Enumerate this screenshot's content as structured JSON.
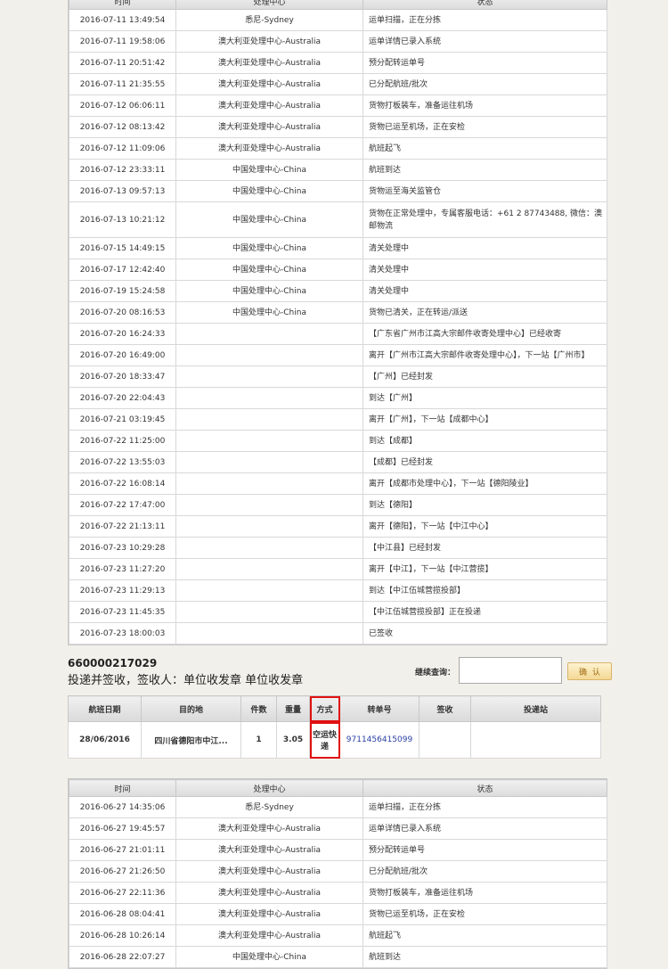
{
  "table1": {
    "headers": {
      "time": "时间",
      "center": "处理中心",
      "status": "状态"
    },
    "rows": [
      {
        "time": "2016-07-11 13:49:54",
        "center": "悉尼-Sydney",
        "status": "运单扫描，正在分拣"
      },
      {
        "time": "2016-07-11 19:58:06",
        "center": "澳大利亚处理中心-Australia",
        "status": "运单详情已录入系统"
      },
      {
        "time": "2016-07-11 20:51:42",
        "center": "澳大利亚处理中心-Australia",
        "status": "预分配转运单号"
      },
      {
        "time": "2016-07-11 21:35:55",
        "center": "澳大利亚处理中心-Australia",
        "status": "已分配航班/批次"
      },
      {
        "time": "2016-07-12 06:06:11",
        "center": "澳大利亚处理中心-Australia",
        "status": "货物打板装车，准备运往机场"
      },
      {
        "time": "2016-07-12 08:13:42",
        "center": "澳大利亚处理中心-Australia",
        "status": "货物已运至机场，正在安检"
      },
      {
        "time": "2016-07-12 11:09:06",
        "center": "澳大利亚处理中心-Australia",
        "status": "航班起飞"
      },
      {
        "time": "2016-07-12 23:33:11",
        "center": "中国处理中心-China",
        "status": "航班到达"
      },
      {
        "time": "2016-07-13 09:57:13",
        "center": "中国处理中心-China",
        "status": "货物运至海关监管仓"
      },
      {
        "time": "2016-07-13 10:21:12",
        "center": "中国处理中心-China",
        "status": "货物在正常处理中，专属客服电话：+61 2 87743488, 微信：澳邮物流"
      },
      {
        "time": "2016-07-15 14:49:15",
        "center": "中国处理中心-China",
        "status": "清关处理中"
      },
      {
        "time": "2016-07-17 12:42:40",
        "center": "中国处理中心-China",
        "status": "清关处理中"
      },
      {
        "time": "2016-07-19 15:24:58",
        "center": "中国处理中心-China",
        "status": "清关处理中"
      },
      {
        "time": "2016-07-20 08:16:53",
        "center": "中国处理中心-China",
        "status": "货物已清关，正在转运/派送"
      },
      {
        "time": "2016-07-20 16:24:33",
        "center": "",
        "status": "【广东省广州市江高大宗邮件收寄处理中心】已经收寄"
      },
      {
        "time": "2016-07-20 16:49:00",
        "center": "",
        "status": "离开【广州市江高大宗邮件收寄处理中心】，下一站【广州市】"
      },
      {
        "time": "2016-07-20 18:33:47",
        "center": "",
        "status": "【广州】已经封发"
      },
      {
        "time": "2016-07-20 22:04:43",
        "center": "",
        "status": "到达【广州】"
      },
      {
        "time": "2016-07-21 03:19:45",
        "center": "",
        "status": "离开【广州】，下一站【成都中心】"
      },
      {
        "time": "2016-07-22 11:25:00",
        "center": "",
        "status": "到达【成都】"
      },
      {
        "time": "2016-07-22 13:55:03",
        "center": "",
        "status": "【成都】已经封发"
      },
      {
        "time": "2016-07-22 16:08:14",
        "center": "",
        "status": "离开【成都市处理中心】，下一站【德阳陵业】"
      },
      {
        "time": "2016-07-22 17:47:00",
        "center": "",
        "status": "到达【德阳】"
      },
      {
        "time": "2016-07-22 21:13:11",
        "center": "",
        "status": "离开【德阳】，下一站【中江中心】"
      },
      {
        "time": "2016-07-23 10:29:28",
        "center": "",
        "status": "【中江县】已经封发"
      },
      {
        "time": "2016-07-23 11:27:20",
        "center": "",
        "status": "离开【中江】，下一站【中江营揽】"
      },
      {
        "time": "2016-07-23 11:29:13",
        "center": "",
        "status": "到达【中江伍城营揽投部】"
      },
      {
        "time": "2016-07-23 11:45:35",
        "center": "",
        "status": "【中江伍城营揽投部】正在投递"
      },
      {
        "time": "2016-07-23 18:00:03",
        "center": "",
        "status": "已签收"
      }
    ]
  },
  "summary": {
    "waybill_no": "660000217029",
    "delivery_note": "投递并签收，签收人：单位收发章 单位收发章"
  },
  "query": {
    "label": "继续查询：",
    "input_value": "",
    "confirm_label": "确认"
  },
  "flight": {
    "headers": {
      "date": "航班日期",
      "destination": "目的地",
      "pieces": "件数",
      "weight": "重量",
      "method": "方式",
      "transfer_no": "转单号",
      "sign": "签收",
      "station": "投递站"
    },
    "row": {
      "date": "28/06/2016",
      "destination": "四川省德阳市中江...",
      "pieces": "1",
      "weight": "3.05",
      "method": "空运快递",
      "transfer_no": "9711456415099",
      "sign": "",
      "station": ""
    }
  },
  "table2": {
    "headers": {
      "time": "时间",
      "center": "处理中心",
      "status": "状态"
    },
    "rows": [
      {
        "time": "2016-06-27 14:35:06",
        "center": "悉尼-Sydney",
        "status": "运单扫描，正在分拣"
      },
      {
        "time": "2016-06-27 19:45:57",
        "center": "澳大利亚处理中心-Australia",
        "status": "运单详情已录入系统"
      },
      {
        "time": "2016-06-27 21:01:11",
        "center": "澳大利亚处理中心-Australia",
        "status": "预分配转运单号"
      },
      {
        "time": "2016-06-27 21:26:50",
        "center": "澳大利亚处理中心-Australia",
        "status": "已分配航班/批次"
      },
      {
        "time": "2016-06-27 22:11:36",
        "center": "澳大利亚处理中心-Australia",
        "status": "货物打板装车，准备运往机场"
      },
      {
        "time": "2016-06-28 08:04:41",
        "center": "澳大利亚处理中心-Australia",
        "status": "货物已运至机场，正在安检"
      },
      {
        "time": "2016-06-28 10:26:14",
        "center": "澳大利亚处理中心-Australia",
        "status": "航班起飞"
      },
      {
        "time": "2016-06-28 22:07:27",
        "center": "中国处理中心-China",
        "status": "航班到达"
      }
    ]
  },
  "colors": {
    "highlight": "#e01010",
    "link": "#2a3fa8",
    "button_bg": "#f4d995"
  }
}
